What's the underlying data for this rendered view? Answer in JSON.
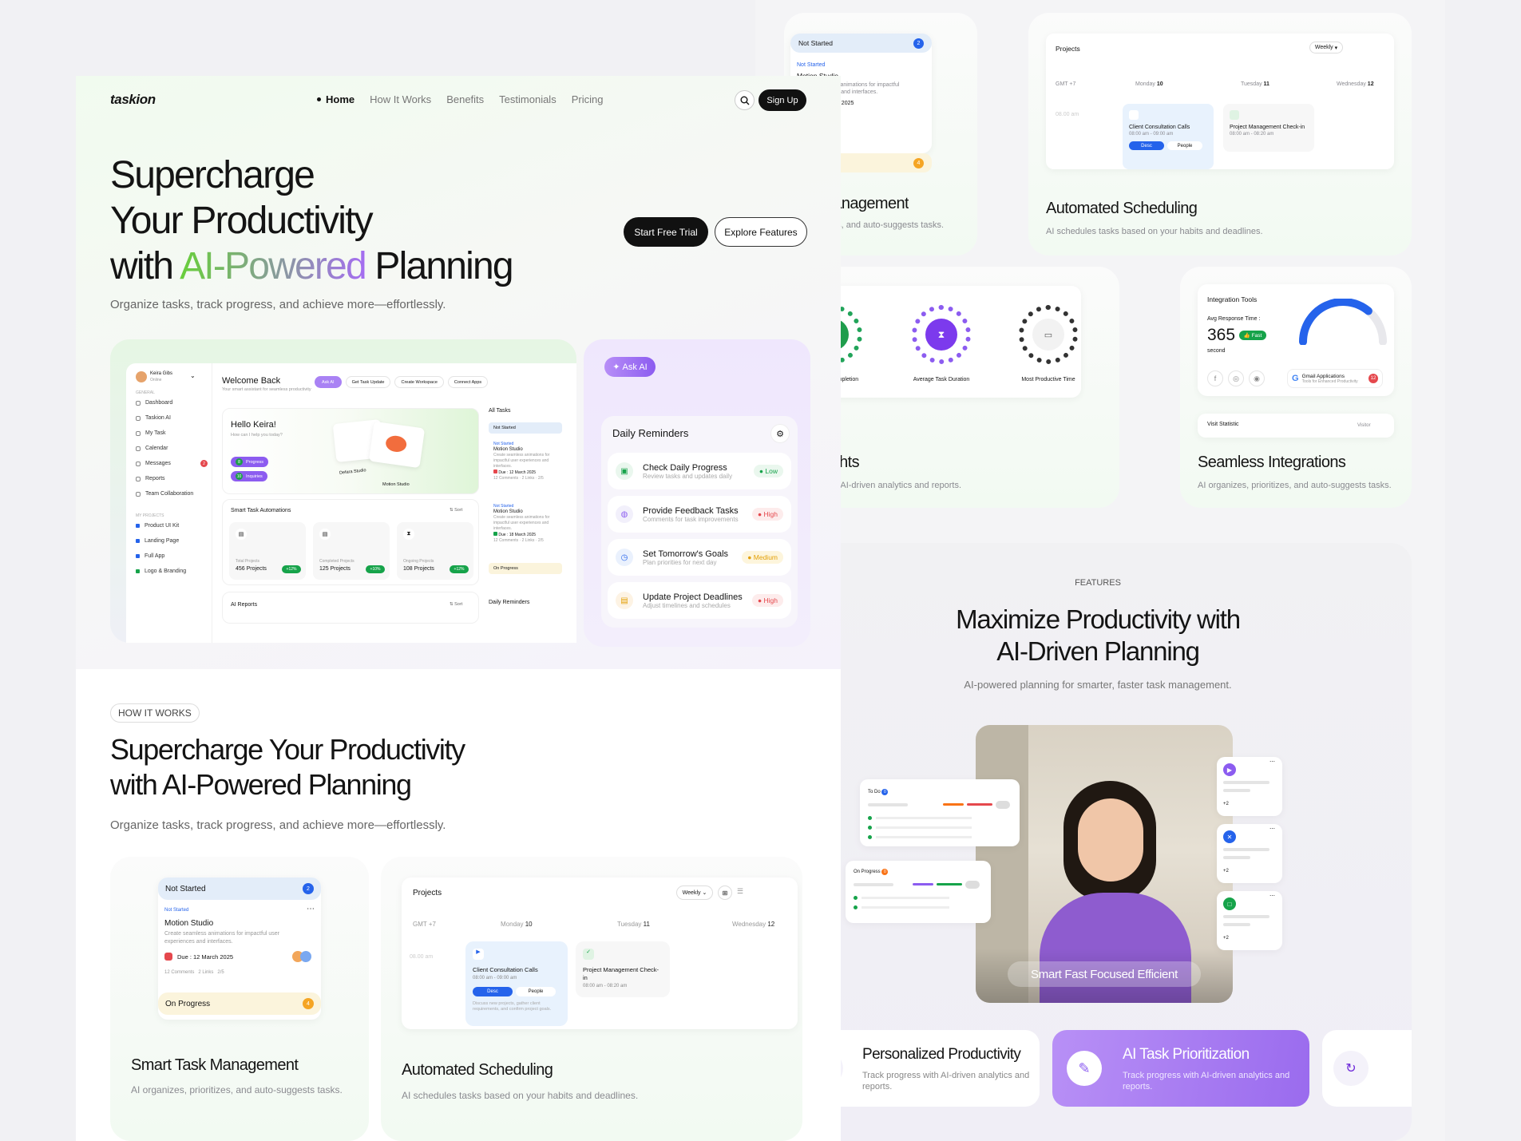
{
  "brand": "taskion",
  "nav": {
    "items": [
      "Home",
      "How It Works",
      "Benefits",
      "Testimonials",
      "Pricing"
    ],
    "signup": "Sign Up"
  },
  "hero": {
    "title_line1": "Supercharge",
    "title_line2": "Your Productivity",
    "title_line3_pre": "with ",
    "title_line3_highlight": "AI-Powered",
    "title_line3_post": " Planning",
    "subtitle": "Organize tasks, track progress, and achieve more—effortlessly.",
    "cta_primary": "Start Free Trial",
    "cta_secondary": "Explore Features"
  },
  "dashboard": {
    "user_name": "Keira Gibs",
    "user_status": "Online",
    "sidebar_section_general": "GENERAL",
    "sidebar_items": [
      "Dashboard",
      "Taskion AI",
      "My Task",
      "Calendar",
      "Messages",
      "Reports",
      "Team Collaboration"
    ],
    "messages_badge": "2",
    "sidebar_section_projects": "MY PROJECTS",
    "projects": [
      "Product UI Kit",
      "Landing Page",
      "Full App",
      "Logo & Branding"
    ],
    "welcome": "Welcome Back",
    "welcome_sub": "Your smart assistant for seamless productivity",
    "chips": [
      "Ask AI",
      "Get Task Update",
      "Create Workspace",
      "Connect Apps"
    ],
    "hello": "Hello Keira!",
    "hello_sub": "How can I help you today?",
    "progress_chip": "Progress",
    "progress_count": "8",
    "inquiries_chip": "Inquiries",
    "inquiries_count": "10",
    "mini_task_a": "Defara Studio",
    "mini_task_b": "Motion Studio",
    "automations_title": "Smart Task Automations",
    "sort_label": "Sort",
    "stats": [
      {
        "label": "Total Projects",
        "value": "456 Projects",
        "delta": "+12%"
      },
      {
        "label": "Completed Projects",
        "value": "125 Projects",
        "delta": "+10%"
      },
      {
        "label": "Ongoing Projects",
        "value": "108 Projects",
        "delta": "+12%"
      }
    ],
    "ai_reports": "AI Reports",
    "all_tasks": "All Tasks",
    "not_started": "Not Started",
    "task_status": "Not Started",
    "task_name": "Motion Studio",
    "task_desc": "Create seamless animations for impactful user experiences and interfaces.",
    "task_due": "Due : 12 March 2025",
    "task_due_b": "Due : 18 March 2025",
    "task_meta": [
      "12 Comments",
      "2 Links",
      "2/5"
    ],
    "on_progress": "On Progress",
    "daily_reminders_small": "Daily Reminders"
  },
  "reminders": {
    "ask_ai": "Ask AI",
    "title": "Daily Reminders",
    "items": [
      {
        "title": "Check Daily Progress",
        "sub": "Review tasks and updates daily",
        "priority": "Low",
        "color": "#22a45a"
      },
      {
        "title": "Provide Feedback Tasks",
        "sub": "Comments for task improvements",
        "priority": "High",
        "color": "#e5484d"
      },
      {
        "title": "Set Tomorrow's Goals",
        "sub": "Plan priorities for next day",
        "priority": "Medium",
        "color": "#e3a008"
      },
      {
        "title": "Update Project Deadlines",
        "sub": "Adjust timelines and schedules",
        "priority": "High",
        "color": "#e5484d"
      }
    ]
  },
  "how": {
    "badge": "HOW IT WORKS",
    "title_line1": "Supercharge Your Productivity",
    "title_line2": "with AI-Powered Planning",
    "subtitle": "Organize tasks, track progress, and achieve more—effortlessly."
  },
  "kanban": {
    "not_started": "Not Started",
    "not_started_count": "2",
    "task_status": "Not Started",
    "task_name": "Motion Studio",
    "task_desc": "Create seamless animations for impactful user experiences and interfaces.",
    "task_due": "Due : 12 March 2025",
    "meta": [
      "12 Comments",
      "2 Links",
      "2/5"
    ],
    "on_progress": "On Progress",
    "on_progress_count": "4"
  },
  "schedule": {
    "title": "Projects",
    "view": "Weekly",
    "tz": "GMT +7",
    "days": [
      {
        "name": "Monday",
        "num": "10"
      },
      {
        "name": "Tuesday",
        "num": "11"
      },
      {
        "name": "Wednesday",
        "num": "12"
      }
    ],
    "time": "08.00 am",
    "event1_title": "Client Consultation Calls",
    "event1_time": "08:00 am - 09:00 am",
    "event1_tab_a": "Desc",
    "event1_tab_b": "People",
    "event1_desc": "Discuss new projects, gather client requirements, and confirm project goals.",
    "event2_title": "Project Management Check-in",
    "event2_time": "08:00 am - 08:20 am"
  },
  "features_top": {
    "smart_title": "Smart Task Management",
    "smart_desc": "AI organizes, prioritizes, and auto-suggests tasks.",
    "auto_title": "Automated Scheduling",
    "auto_desc": "AI schedules tasks based on your habits and deadlines.",
    "insights_title": "Intelligent Insights",
    "insights_desc": "Track progress with AI-driven analytics and reports.",
    "insight_labels": [
      "On-Time Completion",
      "Average Task Duration",
      "Most Productive Time"
    ],
    "integration_title": "Seamless Integrations",
    "integration_desc": "AI organizes, prioritizes, and auto-suggests tasks.",
    "integration_tools": "Integration Tools",
    "avg_response": "Avg Response Time :",
    "response_value": "365",
    "response_unit": "second",
    "fast_badge": "Fast",
    "gmail_label": "Gmail Applications",
    "gmail_sub": "Tools for Enhanced Productivity",
    "gmail_count": "12",
    "visit_statistic": "Visit Statistic",
    "visitor": "Visitor",
    "response_level": 0.72
  },
  "features": {
    "badge": "FEATURES",
    "title_line1": "Maximize Productivity with",
    "title_line2": "AI-Driven Planning",
    "subtitle": "AI-powered planning for smarter, faster task management.",
    "photo_caption": "Smart Fast Focused Efficient",
    "todo_label": "To Do",
    "todo_count": "0",
    "onprog_label": "On Progress",
    "onprog_count": "0",
    "avatar_more": "+2"
  },
  "benefits": [
    {
      "title": "Personalized Productivity",
      "desc": "Track progress with AI-driven analytics and reports."
    },
    {
      "title": "AI Task Prioritization",
      "desc": "Track progress with AI-driven analytics and reports."
    }
  ],
  "colors": {
    "accent_green": "#5bc236",
    "accent_purple": "#8c5cf0",
    "blue": "#2563eb",
    "text": "#141414"
  }
}
